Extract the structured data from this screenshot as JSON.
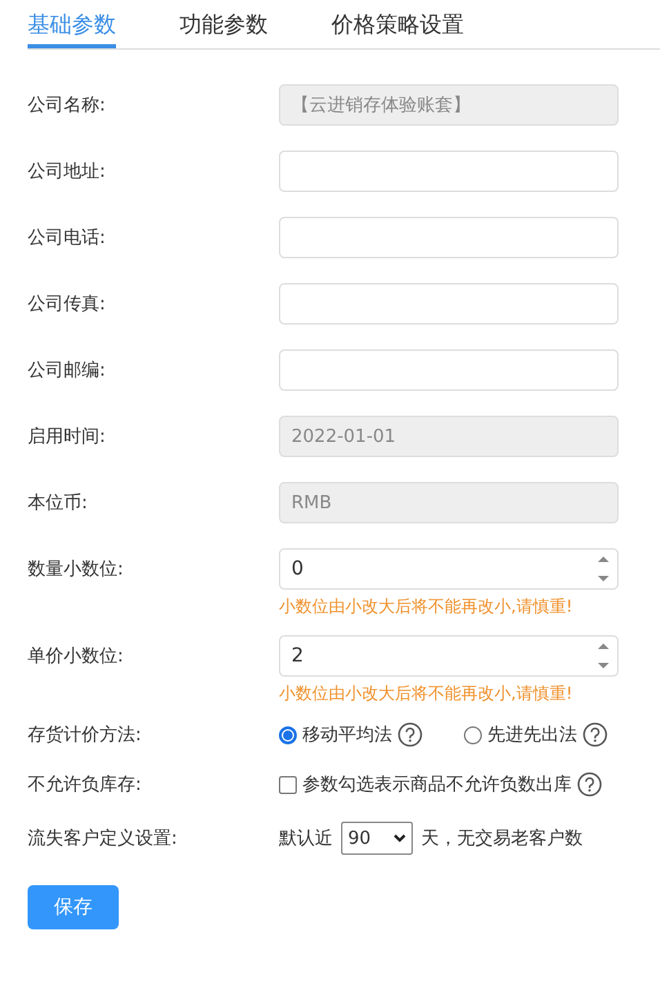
{
  "tabs": [
    {
      "label": "基础参数",
      "selected": true
    },
    {
      "label": "功能参数",
      "selected": false
    },
    {
      "label": "价格策略设置",
      "selected": false
    }
  ],
  "fields": [
    {
      "kind": "text",
      "label": "公司名称:",
      "value": "【云进销存体验账套】",
      "disabled": true
    },
    {
      "kind": "text",
      "label": "公司地址:",
      "disabled": false
    },
    {
      "kind": "text",
      "label": "公司电话:",
      "disabled": false
    },
    {
      "kind": "text",
      "label": "公司传真:",
      "disabled": false
    },
    {
      "kind": "text",
      "label": "公司邮编:",
      "disabled": false
    },
    {
      "kind": "text",
      "label": "启用时间:",
      "value": "2022-01-01",
      "disabled": true
    },
    {
      "kind": "text",
      "label": "本位币:",
      "value": "RMB",
      "disabled": true
    },
    {
      "kind": "number",
      "label": "数量小数位:",
      "value": "0",
      "hint": "小数位由小改大后将不能再改小,请慎重!"
    },
    {
      "kind": "number",
      "label": "单价小数位:",
      "value": "2",
      "hint": "小数位由小改大后将不能再改小,请慎重!"
    },
    {
      "kind": "radio",
      "label": "存货计价方法:",
      "options": [
        {
          "label": "移动平均法",
          "selected": true
        },
        {
          "label": "先进先出法",
          "selected": false
        }
      ]
    },
    {
      "kind": "checkbox",
      "label": "不允许负库存:",
      "text": "参数勾选表示商品不允许负数出库",
      "checked": false
    },
    {
      "kind": "select",
      "label": "流失客户定义设置:",
      "prefix": "默认近",
      "value": "90",
      "suffix": "天，无交易老客户数"
    }
  ],
  "save_button": "保存"
}
